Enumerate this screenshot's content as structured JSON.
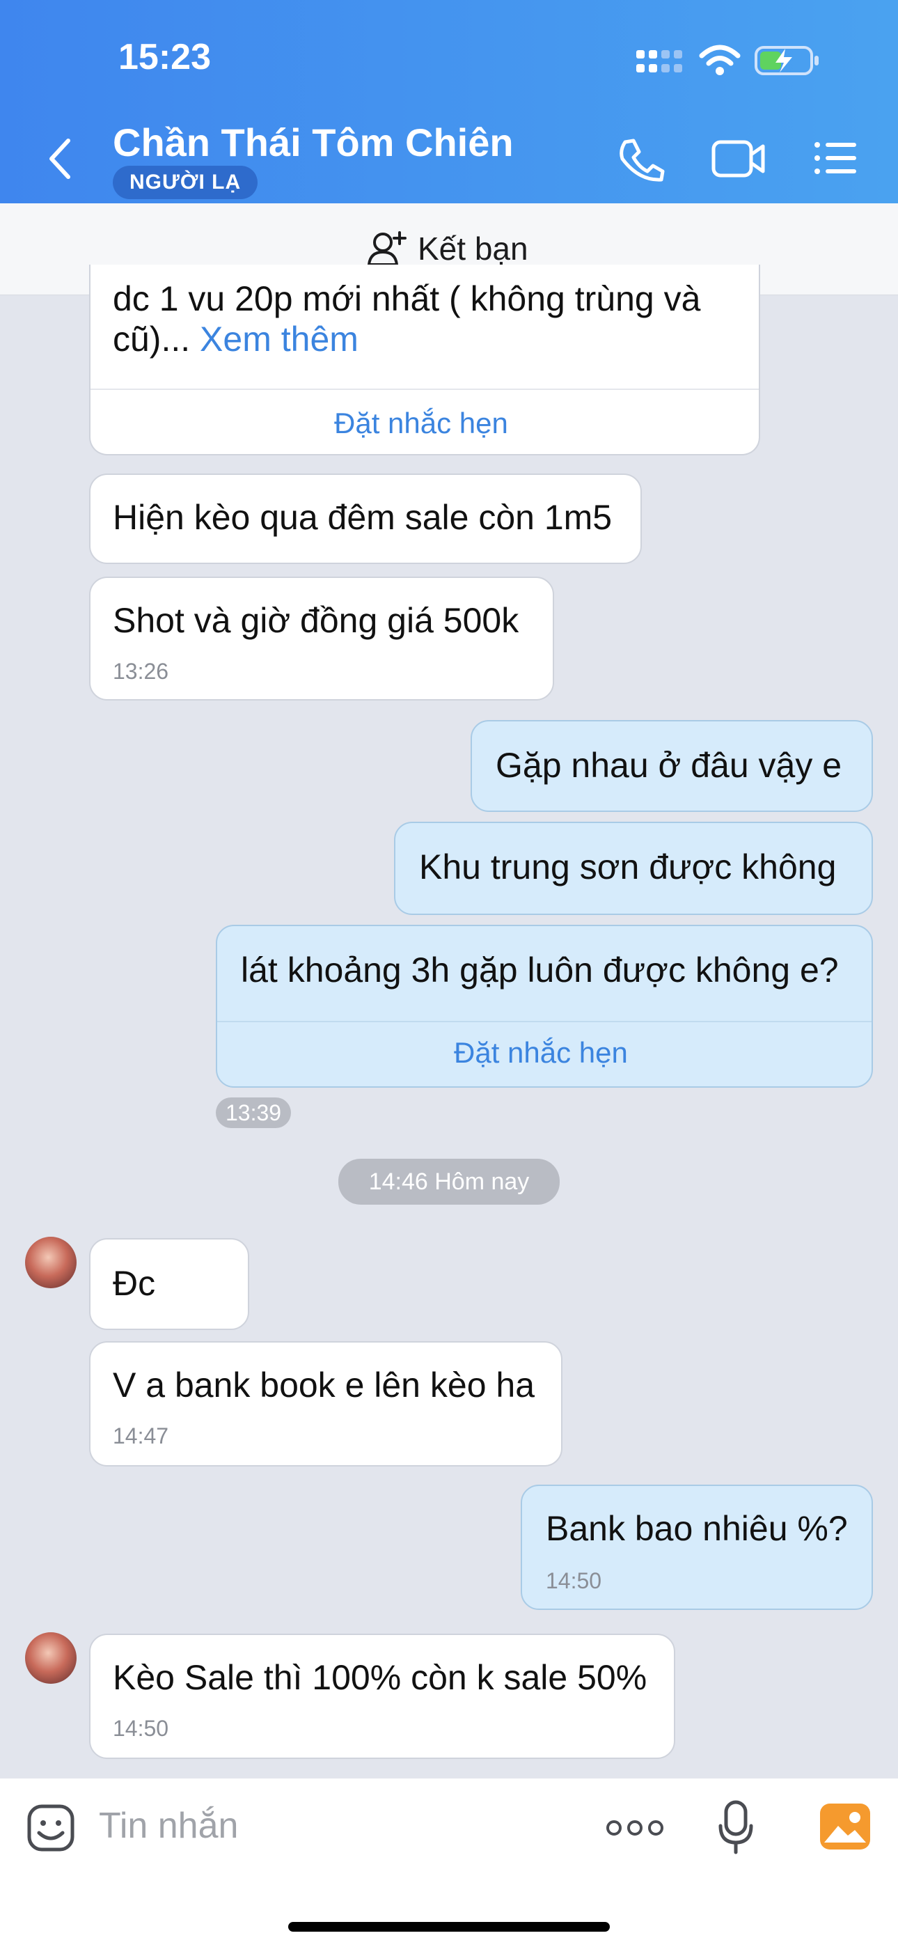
{
  "status": {
    "time": "15:23"
  },
  "header": {
    "contact_name": "Chần Thái Tôm Chiên",
    "badge": "NGƯỜI LẠ"
  },
  "friend_bar": {
    "label": "Kết bạn"
  },
  "messages": {
    "m0": {
      "text_line1": "dc 1 vu 20p mới nhất ( không trùng và",
      "text_line2": "cũ)...",
      "see_more": "Xem thêm",
      "remind": "Đặt nhắc hẹn"
    },
    "m1": {
      "text": "Hiện kèo qua đêm sale còn 1m5"
    },
    "m2": {
      "text": "Shot và giờ đồng giá 500k",
      "time": "13:26"
    },
    "m3": {
      "text": "Gặp nhau ở đâu vậy e"
    },
    "m4": {
      "text": "Khu trung sơn được không"
    },
    "m5": {
      "text": "lát khoảng 3h gặp luôn được không e?",
      "remind": "Đặt nhắc hẹn",
      "time": "13:39"
    },
    "sep": {
      "text": "14:46 Hôm nay"
    },
    "m6": {
      "text": "Đc"
    },
    "m7": {
      "text": "V a bank book e lên kèo ha",
      "time": "14:47"
    },
    "m8": {
      "text": "Bank bao nhiêu %?",
      "time": "14:50"
    },
    "m9": {
      "text": "Kèo Sale thì 100% còn k sale 50%",
      "time": "14:50"
    }
  },
  "input": {
    "placeholder": "Tin nhắn"
  },
  "colors": {
    "header_start": "#3f86ee",
    "header_end": "#4aa2f0",
    "link": "#3b84df",
    "my_bubble": "#d6ebfb",
    "chat_bg": "#e2e5ed"
  },
  "icons": [
    "back-icon",
    "phone-icon",
    "video-icon",
    "menu-icon",
    "add-friend-icon",
    "sticker-icon",
    "more-icon",
    "mic-icon",
    "gallery-icon",
    "signal-icon",
    "wifi-icon",
    "battery-icon"
  ]
}
